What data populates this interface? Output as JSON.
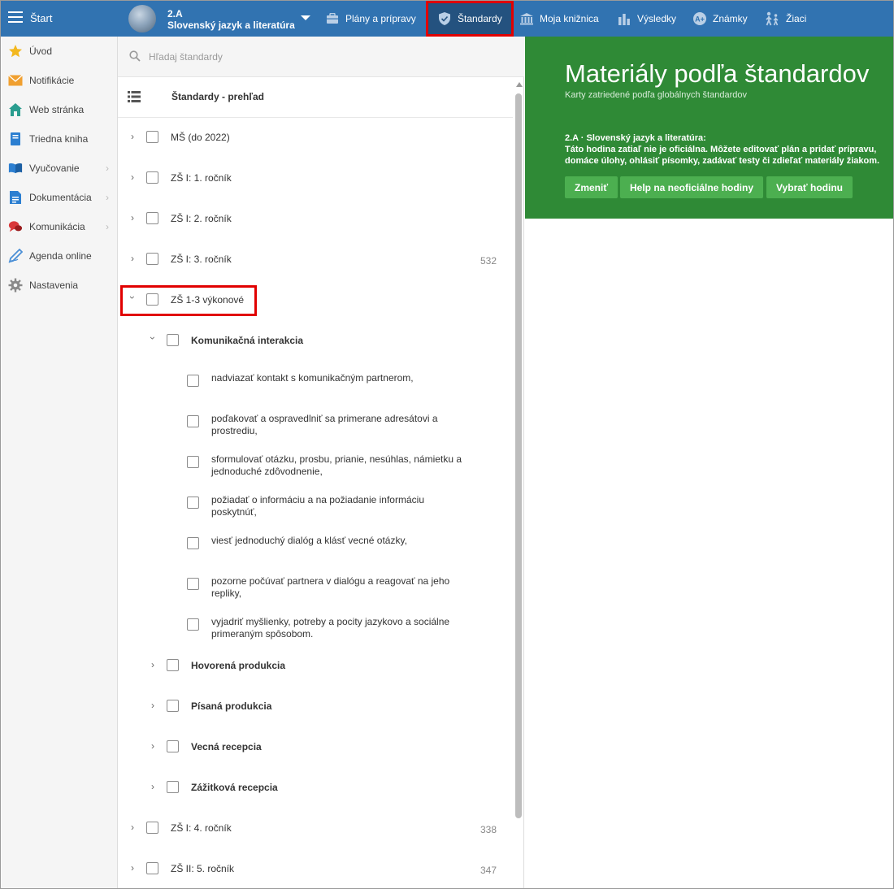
{
  "topbar": {
    "start_label": "Štart",
    "class_name": "2.A",
    "class_subject": "Slovenský jazyk a literatúra",
    "nav": [
      {
        "label": "Plány a prípravy",
        "icon": "briefcase-icon"
      },
      {
        "label": "Štandardy",
        "icon": "shield-check-icon",
        "active": true
      },
      {
        "label": "Moja knižnica",
        "icon": "library-icon"
      },
      {
        "label": "Výsledky",
        "icon": "bar-chart-icon"
      },
      {
        "label": "Známky",
        "icon": "grade-icon"
      },
      {
        "label": "Žiaci",
        "icon": "students-icon"
      }
    ]
  },
  "sidebar": {
    "items": [
      {
        "label": "Úvod",
        "icon": "star-icon"
      },
      {
        "label": "Notifikácie",
        "icon": "envelope-icon"
      },
      {
        "label": "Web stránka",
        "icon": "home-icon"
      },
      {
        "label": "Triedna kniha",
        "icon": "book-icon"
      },
      {
        "label": "Vyučovanie",
        "icon": "open-book-icon"
      },
      {
        "label": "Dokumentácia",
        "icon": "document-icon"
      },
      {
        "label": "Komunikácia",
        "icon": "chat-icon"
      },
      {
        "label": "Agenda online",
        "icon": "pen-icon"
      },
      {
        "label": "Nastavenia",
        "icon": "gear-icon"
      }
    ]
  },
  "panel": {
    "search_placeholder": "Hľadaj štandardy",
    "overview_label": "Štandardy - prehľad",
    "tree": [
      {
        "label": "MŠ (do 2022)",
        "level": 0,
        "expanded": false,
        "count": ""
      },
      {
        "label": "ZŠ I: 1. ročník",
        "level": 0,
        "expanded": false,
        "count": ""
      },
      {
        "label": "ZŠ I: 2. ročník",
        "level": 0,
        "expanded": false,
        "count": ""
      },
      {
        "label": "ZŠ I: 3. ročník",
        "level": 0,
        "expanded": false,
        "count": "532"
      },
      {
        "label": "ZŠ 1-3 výkonové",
        "level": 0,
        "expanded": true,
        "count": "",
        "highlighted": true
      },
      {
        "label": "Komunikačná interakcia",
        "level": 1,
        "expanded": true,
        "count": ""
      },
      {
        "label": "nadviazať kontakt s komunikačným partnerom,",
        "level": 2,
        "count": ""
      },
      {
        "label": "poďakovať a ospravedlniť sa primerane adresátovi a prostrediu,",
        "level": 2,
        "count": ""
      },
      {
        "label": "sformulovať otázku, prosbu, prianie, nesúhlas, námietku a jednoduché zdôvodnenie,",
        "level": 2,
        "count": ""
      },
      {
        "label": "požiadať o informáciu a na požiadanie informáciu poskytnúť,",
        "level": 2,
        "count": ""
      },
      {
        "label": "viesť jednoduchý dialóg a klásť vecné otázky,",
        "level": 2,
        "count": ""
      },
      {
        "label": "pozorne počúvať partnera v dialógu a reagovať na jeho repliky,",
        "level": 2,
        "count": ""
      },
      {
        "label": "vyjadriť myšlienky, potreby a pocity jazykovo a sociálne primeraným spôsobom.",
        "level": 2,
        "count": ""
      },
      {
        "label": "Hovorená produkcia",
        "level": 1,
        "expanded": false,
        "count": ""
      },
      {
        "label": "Písaná produkcia",
        "level": 1,
        "expanded": false,
        "count": ""
      },
      {
        "label": "Vecná recepcia",
        "level": 1,
        "expanded": false,
        "count": ""
      },
      {
        "label": "Zážitková recepcia",
        "level": 1,
        "expanded": false,
        "count": ""
      },
      {
        "label": "ZŠ I: 4. ročník",
        "level": 0,
        "expanded": false,
        "count": "338"
      },
      {
        "label": "ZŠ II: 5. ročník",
        "level": 0,
        "expanded": false,
        "count": "347"
      }
    ]
  },
  "banner": {
    "title": "Materiály podľa štandardov",
    "subtitle": "Karty zatriedené podľa globálnych štandardov",
    "class_line": "2.A · Slovenský jazyk a literatúra:",
    "info_line1": "Táto hodina zatiaľ nie je oficiálna. Môžete editovať plán a pridať prípravu,",
    "info_line2": "domáce úlohy, ohlásiť písomky, zadávať testy či zdieľať materiály žiakom.",
    "buttons": {
      "change": "Zmeniť",
      "help": "Help na neoficiálne hodiny",
      "select": "Vybrať hodinu"
    }
  },
  "colors": {
    "topbar": "#3173b1",
    "banner": "#2f8a36",
    "button": "#4caf50",
    "highlight": "#e10000"
  }
}
